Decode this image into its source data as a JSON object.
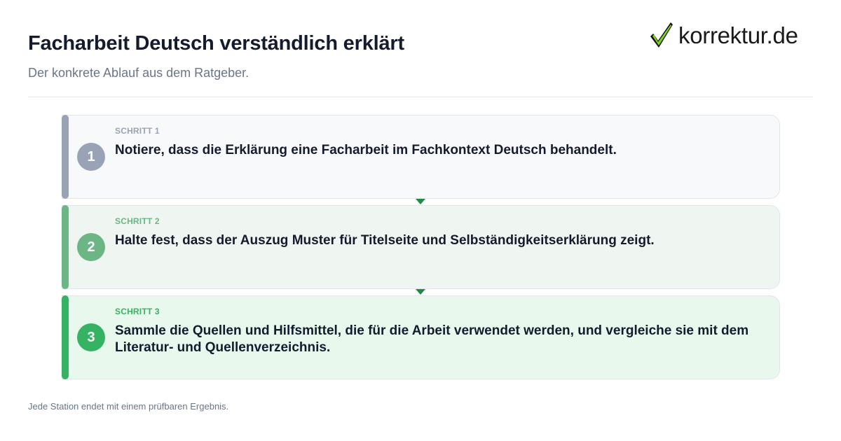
{
  "header": {
    "title": "Facharbeit Deutsch verständlich erklärt",
    "subtitle": "Der konkrete Ablauf aus dem Ratgeber."
  },
  "logo": {
    "text": "korrektur.de",
    "icon": "checkmark-icon"
  },
  "steps": [
    {
      "number": "1",
      "label": "SCHRITT 1",
      "text": "Notiere, dass die Erklärung eine Facharbeit im Fachkontext Deutsch behandelt.",
      "accent": "#9aa3b5",
      "background": "#f8f9fb"
    },
    {
      "number": "2",
      "label": "SCHRITT 2",
      "text": "Halte fest, dass der Auszug Muster für Titelseite und Selbständigkeitserklärung zeigt.",
      "accent": "#6cb585",
      "background": "#eff5f0"
    },
    {
      "number": "3",
      "label": "SCHRITT 3",
      "text": "Sammle die Quellen und Hilfsmittel, die für die Arbeit verwendet werden, und vergleiche sie mit dem Literatur- und Quellenverzeichnis.",
      "accent": "#36b263",
      "background": "#e8f8ec"
    }
  ],
  "connector_color": "#1e8a46",
  "footer": {
    "note": "Jede Station endet mit einem prüfbaren Ergebnis."
  }
}
